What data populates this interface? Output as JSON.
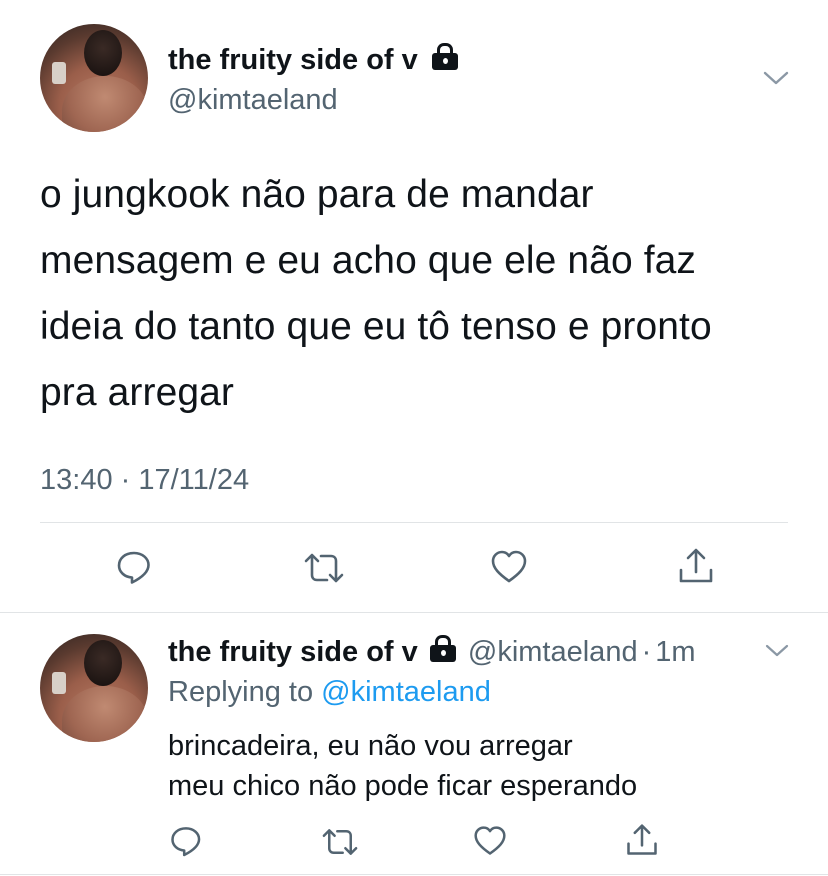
{
  "main_tweet": {
    "display_name": "the fruity side of v",
    "handle": "@kimtaeland",
    "text_lines": [
      "o jungkook não para de mandar",
      "mensagem e eu acho que ele não faz",
      "ideia do tanto que eu tô tenso e pronto",
      "pra arregar"
    ],
    "timestamp": "13:40 · 17/11/24"
  },
  "reply_tweet": {
    "display_name": "the fruity side of v",
    "handle": "@kimtaeland",
    "separator": "·",
    "age": "1m",
    "replying_prefix": "Replying to",
    "replying_to": "@kimtaeland",
    "text_lines": [
      "brincadeira, eu não vou arregar",
      "meu chico não pode ficar esperando"
    ]
  },
  "icons": {
    "lock": "lock-icon",
    "menu": "chevron-down-icon",
    "reply": "reply-icon",
    "retweet": "retweet-icon",
    "like": "heart-icon",
    "share": "share-icon"
  },
  "colors": {
    "text": "#0f1419",
    "muted": "#536471",
    "link": "#1d9bf0",
    "divider": "#e1e4e6"
  }
}
